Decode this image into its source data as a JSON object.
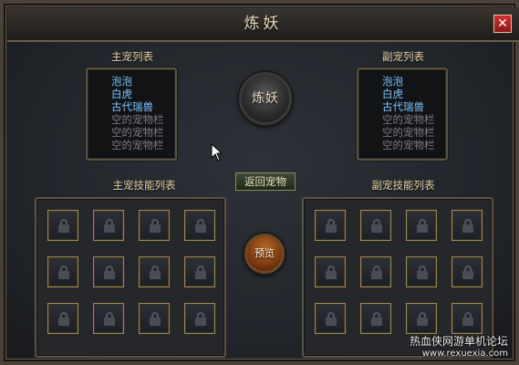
{
  "window": {
    "title": "炼妖",
    "close_label": "✕"
  },
  "main_pet_list": {
    "label": "主宠列表",
    "items": [
      {
        "text": "泡泡",
        "state": "active"
      },
      {
        "text": "白虎",
        "state": "active"
      },
      {
        "text": "古代瑞兽",
        "state": "active"
      },
      {
        "text": "空的宠物栏",
        "state": "empty"
      },
      {
        "text": "空的宠物栏",
        "state": "empty"
      },
      {
        "text": "空的宠物栏",
        "state": "empty"
      }
    ]
  },
  "sub_pet_list": {
    "label": "副宠列表",
    "items": [
      {
        "text": "泡泡",
        "state": "active"
      },
      {
        "text": "白虎",
        "state": "active"
      },
      {
        "text": "古代瑞兽",
        "state": "active"
      },
      {
        "text": "空的宠物栏",
        "state": "empty"
      },
      {
        "text": "空的宠物栏",
        "state": "empty"
      },
      {
        "text": "空的宠物栏",
        "state": "empty"
      }
    ]
  },
  "refine_button_label": "炼妖",
  "return_button_label": "返回宠物",
  "preview_button_label": "预览",
  "main_skill_list": {
    "label": "主宠技能列表",
    "locked_slots": 12
  },
  "sub_skill_list": {
    "label": "副宠技能列表",
    "locked_slots": 12
  },
  "watermark": {
    "line1": "热血侠网游单机论坛",
    "line2": "www.rexuexia.com"
  },
  "colors": {
    "active_text": "#7ec4ff",
    "empty_text": "#7c7e82",
    "label_text": "#e8d8a8",
    "slot_border": "#a08850"
  }
}
